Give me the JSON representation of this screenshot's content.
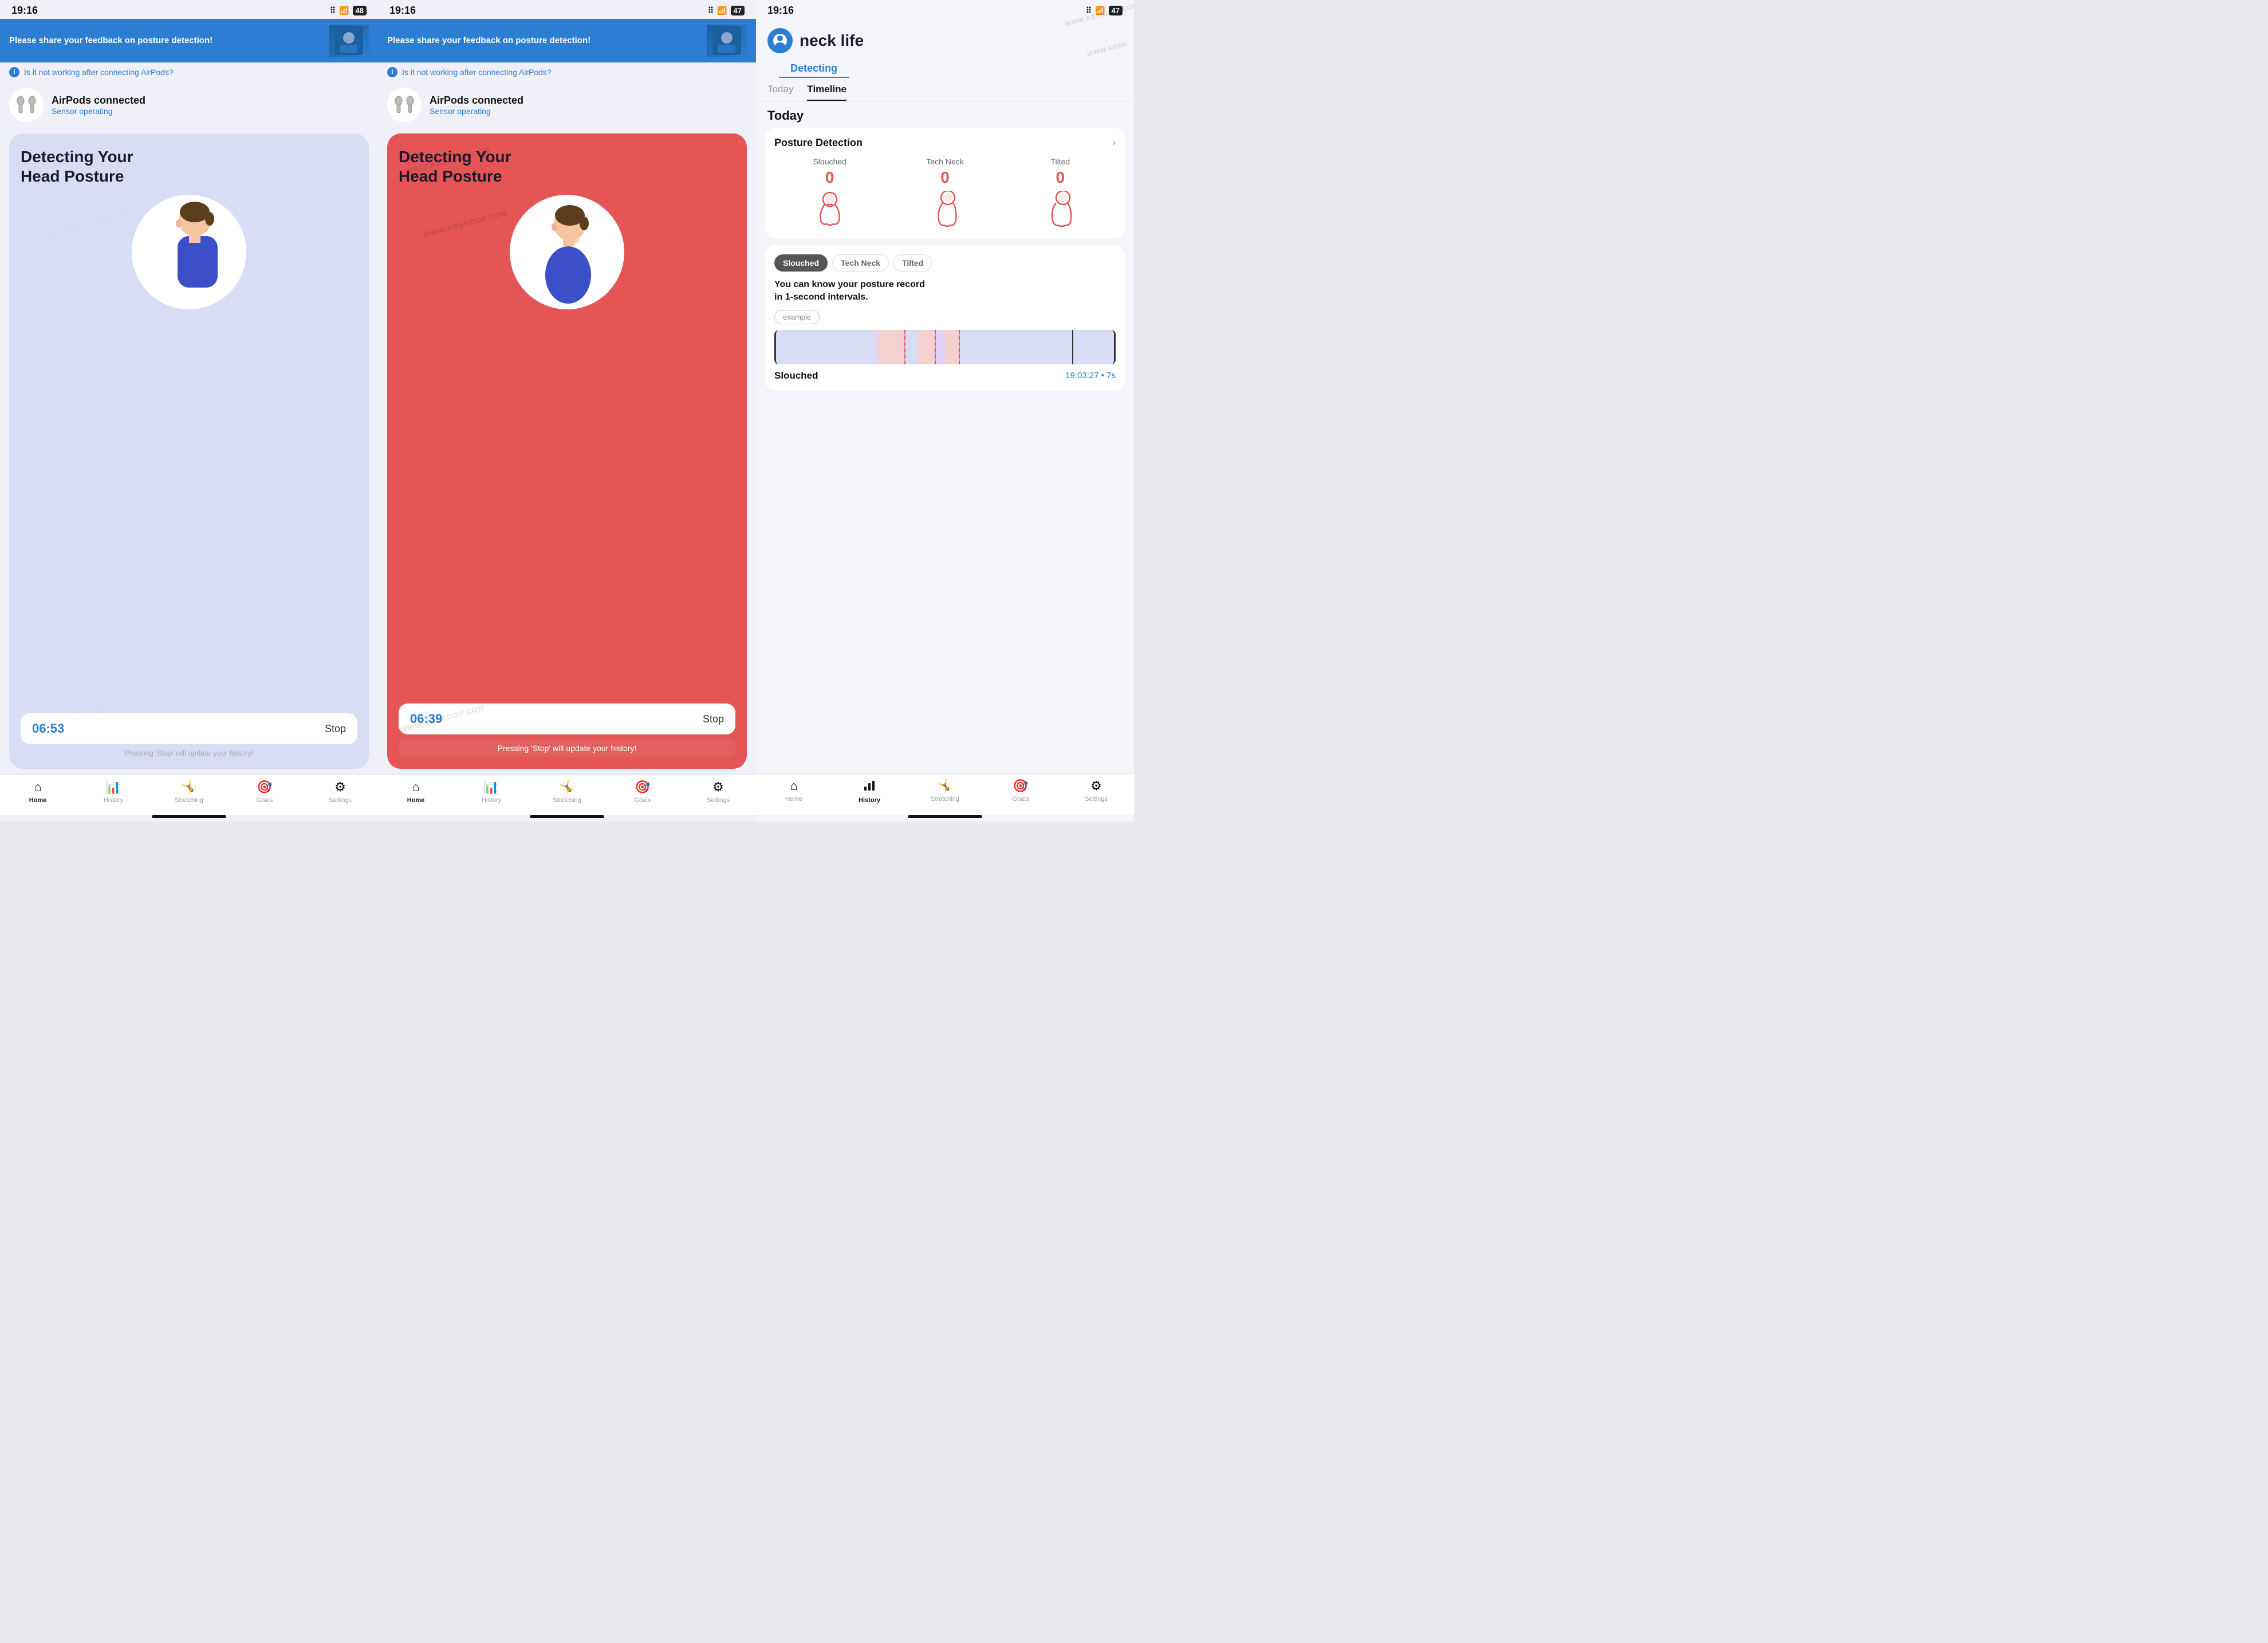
{
  "panels": [
    {
      "id": "panel-1",
      "type": "blue-detecting",
      "statusBar": {
        "time": "19:16",
        "signal": ":::.",
        "wifi": "wifi",
        "battery": "48"
      },
      "feedbackBanner": {
        "text": "Please share your feedback on posture detection!",
        "hasImage": true
      },
      "infoRow": "Is it not working after connecting AirPods?",
      "airpods": {
        "name": "AirPods connected",
        "status": "Sensor operating"
      },
      "card": {
        "type": "blue",
        "title": "Detecting Your\nHead Posture",
        "timer": "06:53",
        "stopLabel": "Stop",
        "hint": "Pressing 'Stop' will update your history!"
      },
      "tabs": [
        "Home",
        "History",
        "Stretching",
        "Goals",
        "Settings"
      ],
      "activeTab": "Home"
    },
    {
      "id": "panel-2",
      "type": "red-detecting",
      "statusBar": {
        "time": "19:16",
        "signal": ":::.",
        "wifi": "wifi",
        "battery": "47"
      },
      "feedbackBanner": {
        "text": "Please share your feedback on posture detection!",
        "hasImage": true
      },
      "infoRow": "Is it not working after connecting AirPods?",
      "airpods": {
        "name": "AirPods connected",
        "status": "Sensor operating"
      },
      "card": {
        "type": "red",
        "title": "Detecting Your\nHead Posture",
        "timer": "06:39",
        "stopLabel": "Stop",
        "hint": "Pressing 'Stop' will update your history!"
      },
      "tabs": [
        "Home",
        "History",
        "Stretching",
        "Goals",
        "Settings"
      ],
      "activeTab": "Home"
    },
    {
      "id": "panel-3",
      "type": "history",
      "statusBar": {
        "time": "19:16",
        "signal": ":::.",
        "wifi": "wifi",
        "battery": "47"
      },
      "appName": "neck life",
      "detectingLabel": "Detecting",
      "tabs": [
        "Today",
        "Timeline"
      ],
      "activeTab": "Timeline",
      "sectionTitle": "Today",
      "postureCard": {
        "title": "Posture Detection",
        "types": [
          {
            "name": "Slouched",
            "count": "0"
          },
          {
            "name": "Tech Neck",
            "count": "0"
          },
          {
            "name": "Tilted",
            "count": "0"
          }
        ]
      },
      "timelineCard": {
        "chips": [
          "Slouched",
          "Tech Neck",
          "Tilted"
        ],
        "activeChip": "Slouched",
        "infoText": "You can know your posture record\nin 1-second intervals.",
        "exampleChip": "example",
        "postureLabel": "Slouched",
        "postureTime": "19:03:27 • 7s"
      },
      "bottomTabs": [
        "Home",
        "History",
        "Stretching",
        "Goals",
        "Settings"
      ],
      "activeBottomTab": "History"
    }
  ],
  "watermarkText": "WWW.ABSKOOP.COM"
}
